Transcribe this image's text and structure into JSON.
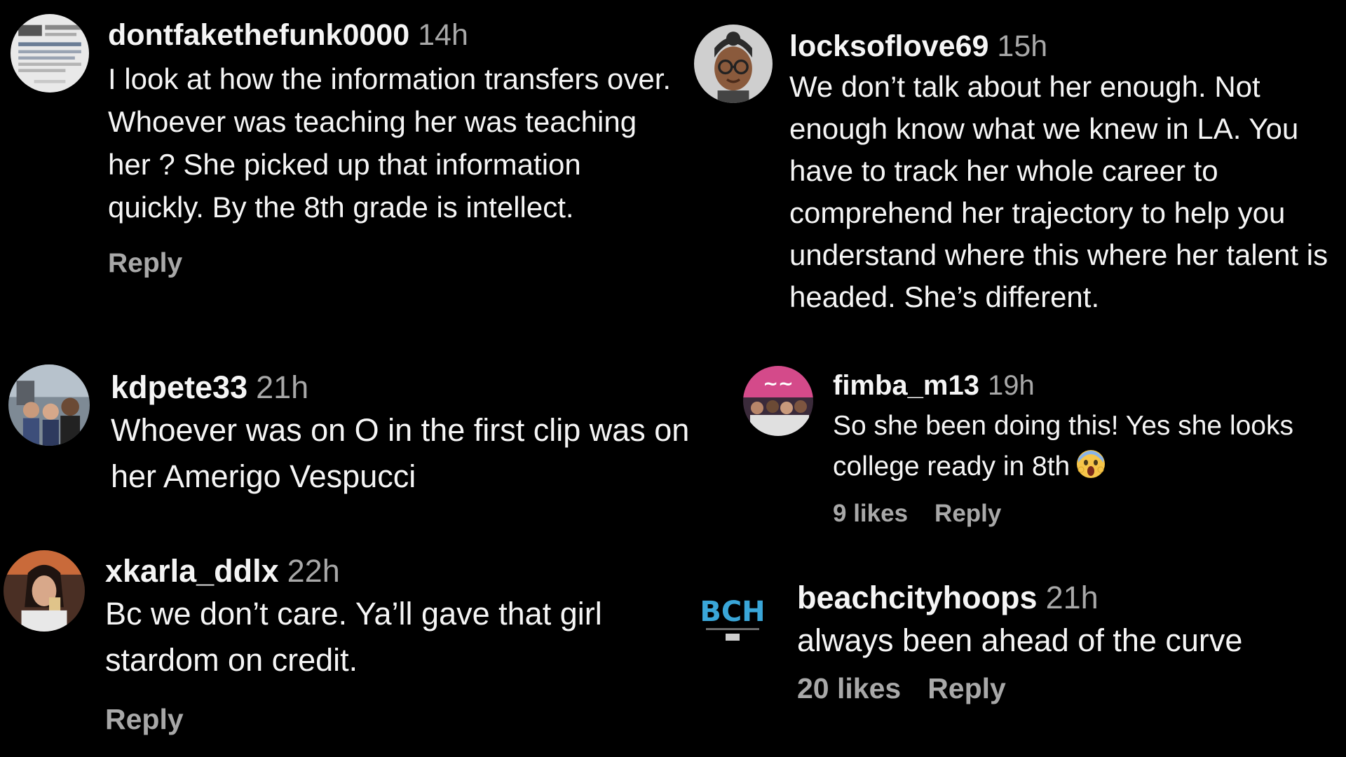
{
  "comments": [
    {
      "username": "dontfakethefunk0000",
      "time": "14h",
      "text": "I look at how the information transfers over. Whoever was teaching her was teaching her ? She picked up that information quickly. By the 8th grade is intellect.",
      "reply": "Reply",
      "avatar_icon": "news-headline-avatar"
    },
    {
      "username": "locksoflove69",
      "time": "15h",
      "text": "We don’t talk about her enough. Not enough know what we knew in LA. You have to track her whole career to comprehend her trajectory to help you understand where this where her talent is headed. She’s different.",
      "avatar_icon": "cartoon-avatar-with-glasses"
    },
    {
      "username": "kdpete33",
      "time": "21h",
      "text": "Whoever was on O in the first clip was on her Amerigo Vespucci",
      "avatar_icon": "group-photo-avatar"
    },
    {
      "username": "fimba_m13",
      "time": "19h",
      "text": "So she been doing this! Yes she looks college ready in 8th",
      "emoji": "face-screaming-emoji",
      "likes": "9 likes",
      "reply": "Reply",
      "avatar_icon": "group-photo-avatar"
    },
    {
      "username": "xkarla_ddlx",
      "time": "22h",
      "text": "Bc we don’t care. Ya’ll gave that girl stardom on credit.",
      "reply": "Reply",
      "avatar_icon": "portrait-photo-avatar"
    },
    {
      "username": "beachcityhoops",
      "time": "21h",
      "text": "always been ahead of the curve",
      "likes": "20 likes",
      "reply": "Reply",
      "avatar_icon": "bch-logo-avatar",
      "logo_text": "BCH"
    }
  ],
  "colors": {
    "background": "#000000",
    "text": "#f5f5f5",
    "muted": "#a8a8a8",
    "logo": "#3aa6d8"
  }
}
